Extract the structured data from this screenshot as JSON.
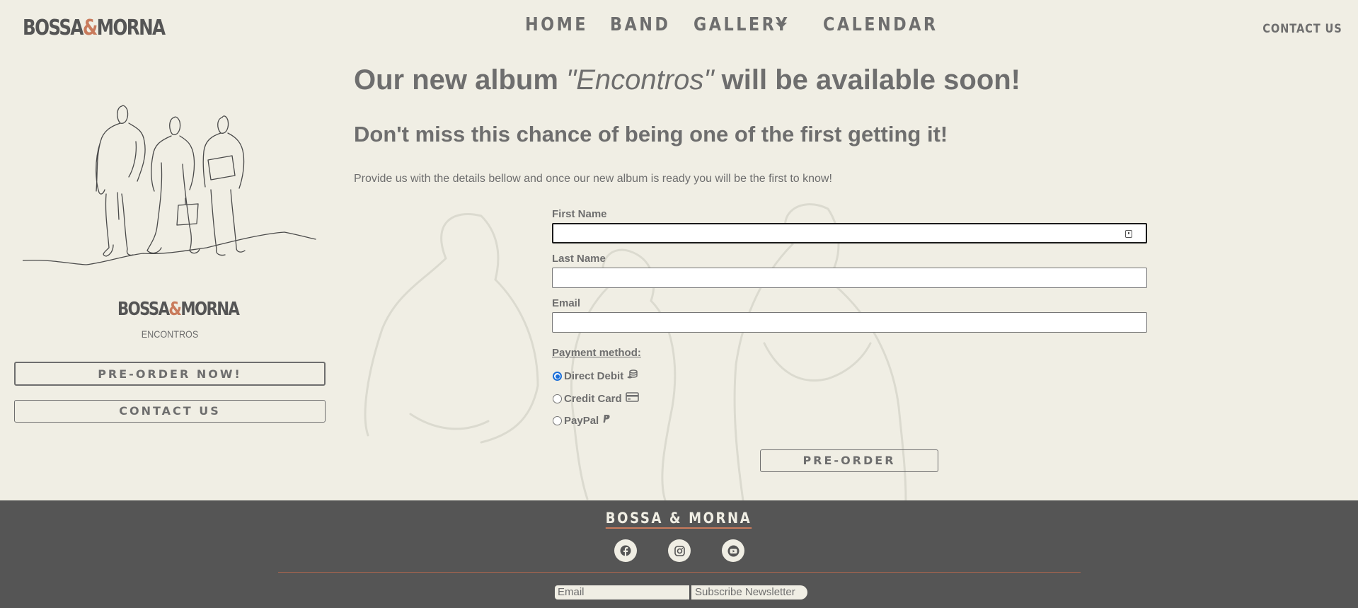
{
  "brand": {
    "name_left": "BOSSA",
    "amp": "&",
    "name_right": "MORNA"
  },
  "nav": {
    "home": "HOME",
    "band": "BAND",
    "gallery": "GALLERY",
    "calendar": "CALENDAR",
    "contact": "CONTACT US"
  },
  "sidebar": {
    "album_subtitle": "ENCONTROS",
    "preorder_label": "PRE-ORDER NOW!",
    "contact_label": "CONTACT US"
  },
  "main": {
    "heading_prefix": "Our new album ",
    "album_name": "\"Encontros\"",
    "heading_suffix": " will be available soon!",
    "subheading": "Don't miss this chance of being one of the first getting it!",
    "lead": "Provide us with the details bellow and once our new album is ready you will be the first to know!"
  },
  "form": {
    "first_name_label": "First Name",
    "first_name_value": "",
    "last_name_label": "Last Name",
    "last_name_value": "",
    "email_label": "Email",
    "email_value": "",
    "payment_title": "Payment method:",
    "payment_options": [
      {
        "label": "Direct Debit",
        "icon": "coins-icon",
        "selected": true
      },
      {
        "label": "Credit Card",
        "icon": "credit-card-icon",
        "selected": false
      },
      {
        "label": "PayPal",
        "icon": "paypal-icon",
        "selected": false
      }
    ],
    "submit_label": "PRE-ORDER"
  },
  "footer": {
    "title": "BOSSA & MORNA",
    "socials": [
      "facebook-icon",
      "instagram-icon",
      "youtube-icon"
    ],
    "newsletter_placeholder": "Email",
    "newsletter_button": "Subscribe Newsletter"
  },
  "colors": {
    "background": "#f0eee4",
    "text": "#6e6e6e",
    "footer": "#555555",
    "accent": "#c97b5c",
    "radio": "#1a6ed8"
  }
}
